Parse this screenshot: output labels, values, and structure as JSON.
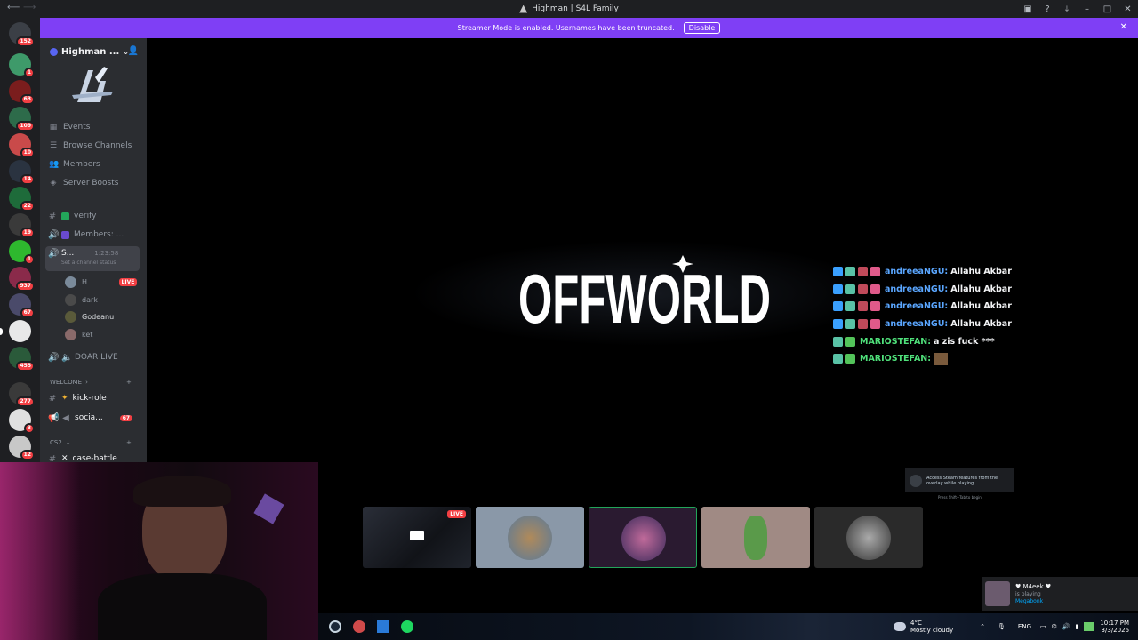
{
  "window": {
    "title": "Highman | S4L Family"
  },
  "banner": {
    "text": "Streamer Mode is enabled. Usernames have been truncated.",
    "disable_label": "Disable"
  },
  "server_rail": {
    "badges": [
      "152",
      "1",
      "63",
      "109",
      "10",
      "14",
      "22",
      "19",
      "1",
      "937",
      "67",
      "455",
      "277",
      "3",
      "12"
    ]
  },
  "sidebar": {
    "server_name": "Highman ...",
    "nav": [
      {
        "label": "Events",
        "icon": "calendar-icon"
      },
      {
        "label": "Browse Channels",
        "icon": "list-icon"
      },
      {
        "label": "Members",
        "icon": "members-icon"
      },
      {
        "label": "Server Boosts",
        "icon": "boost-icon"
      }
    ],
    "channels": {
      "verify": "verify",
      "members": "Members: ...",
      "selected_name": "S...",
      "selected_time": "1:23:58",
      "selected_status": "Set a channel status",
      "voice_users": [
        {
          "name": "H...",
          "live": "LIVE"
        },
        {
          "name": "dark"
        },
        {
          "name": "Godeanu"
        },
        {
          "name": "ket"
        }
      ],
      "doar_live": "DOAR LIVE",
      "welcome_category": "WELCOME",
      "kick_role": "kick-role",
      "social": "socia...",
      "social_badge": "67",
      "cs2_category": "CS2",
      "case_battle": "case-battle"
    }
  },
  "stream": {
    "logo_text": "OFFWORLD",
    "chat": [
      {
        "name": "andreeaNGU:",
        "msg": "Allahu Akbar"
      },
      {
        "name": "andreeaNGU:",
        "msg": "Allahu Akbar"
      },
      {
        "name": "andreeaNGU:",
        "msg": "Allahu Akbar"
      },
      {
        "name": "andreeaNGU:",
        "msg": "Allahu Akbar"
      },
      {
        "name": "MARIOSTEFAN:",
        "msg": "a zis fuck ***"
      },
      {
        "name": "MARIOSTEFAN:",
        "msg": ""
      }
    ],
    "steam_toast": "Access Steam features from the overlay while playing.",
    "steam_hint": "Press Shift+Tab to begin",
    "tile_live": "LIVE"
  },
  "presence": {
    "name": "♥ M4eek ♥",
    "status": "is playing",
    "game": "Megabonk"
  },
  "taskbar": {
    "weather_temp": "4°C",
    "weather_desc": "Mostly cloudy",
    "lang": "ENG",
    "time": "10:17 PM",
    "date": "3/3/2026"
  },
  "colors": {
    "accent_purple": "#7f3ff5",
    "live_red": "#f23f43",
    "link_blue": "#5aa6ff",
    "online_green": "#23a55a"
  }
}
